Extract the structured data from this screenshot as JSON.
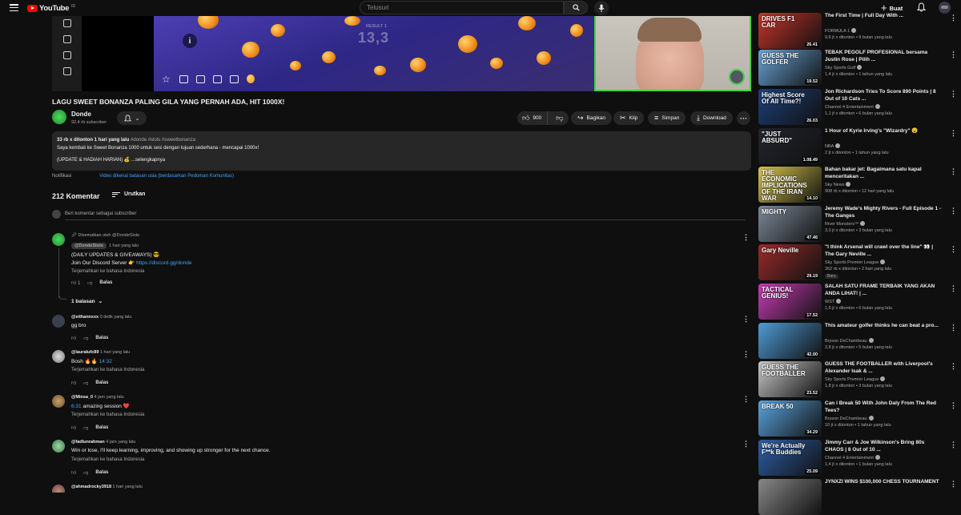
{
  "header": {
    "logo_text": "YouTube",
    "logo_region": "ID",
    "search_placeholder": "Telusuri",
    "create_label": "Buat"
  },
  "video": {
    "title": "LAGU SWEET BONANZA PALING GILA YANG PERNAH ADA, HIT 1000X!",
    "game_text": "13,3",
    "game_small_text": "RESULT 1"
  },
  "channel": {
    "name": "Donde",
    "subs": "92,4 rb subscriber"
  },
  "actions": {
    "likes": "900",
    "share": "Bagikan",
    "clip": "Klip",
    "save": "Simpan",
    "download": "Download",
    "more": "···"
  },
  "description": {
    "meta": "33 rb x ditonton  1 hari yang lalu",
    "tags": "#donde #slots #sweetbonanza",
    "line1": "Saya kembali ke Sweet Bonanza 1000 untuk sesi dengan tujuan sederhana - mencapai 1000x!",
    "line2": "(UPDATE & HADIAH HARIAN) 💰 ...selengkapnya"
  },
  "notifications": {
    "label": "Notifikasi",
    "link": "Video dikenai batasan usia (berdasarkan Pedoman Komunitas)"
  },
  "comments": {
    "count": "212 Komentar",
    "sort_label": "Urutkan",
    "add_placeholder": "Beri komentar sebagai subscriber",
    "reply_label": "Balas",
    "translate_label": "Terjemahkan ke bahasa Indonesia",
    "pinned": {
      "pinned_by": "Disematkan oleh @DondeSlots",
      "author": "@DondeSlots",
      "time": "1 hari yang lalu",
      "line1": "(DAILY UPDATES & GIVEAWAYS) 😎",
      "line2_text": "Join Our Discord Server 👉 ",
      "line2_link": "https://discord.gg/donde",
      "likes": "1",
      "replies": "1 balasan"
    },
    "items": [
      {
        "author": "@eithannxxx",
        "time": "0 detik yang lalu",
        "text": "gg bro",
        "link": ""
      },
      {
        "author": "@lauralufc89",
        "time": "1 hari yang lalu",
        "text": "Bosh 🔥🔥 ",
        "link": "14:32"
      },
      {
        "author": "@Minsa_0",
        "time": "4 jam yang lalu",
        "text": " amazing session ❤️",
        "link": "6:31"
      },
      {
        "author": "@fadlunrahman",
        "time": "4 jam yang lalu",
        "text": "Win or lose, I'll keep learning, improving, and showing up stronger for the next chance.",
        "link": ""
      },
      {
        "author": "@ahmadrocky3918",
        "time": "1 hari yang lalu",
        "text": "",
        "link": ""
      }
    ]
  },
  "recommendations": [
    {
      "title": "The First Time | Full Day With ...",
      "channel": "FORMULA 1",
      "meta": "9,6 jt x ditonton • 9 bulan yang lalu",
      "duration": "26.41",
      "thumb_text": "DRIVES F1 CAR",
      "color": "#c7342a"
    },
    {
      "title": "TEBAK PEGOLF PROFESIONAL bersama Justin Rose | Pilih ...",
      "channel": "Sky Sports Golf",
      "meta": "1,4 jt x ditonton • 1 tahun yang lalu",
      "duration": "19.52",
      "thumb_text": "GUESS THE GOLFER",
      "color": "#6aa4d8"
    },
    {
      "title": "Jon Richardson Tries To Score 890 Points | 8 Out of 10 Cats ...",
      "channel": "Channel 4 Entertainment",
      "meta": "1,1 jt x ditonton • 6 bulan yang lalu",
      "duration": "26.03",
      "thumb_text": "Highest Score Of All Time?!",
      "color": "#1d3f7a"
    },
    {
      "title": "1 Hour of Kyrie Irving's \"Wizardry\" 😮",
      "channel": "NBA",
      "meta": "2 jt x ditonton • 1 tahun yang lalu",
      "duration": "1.08.49",
      "thumb_text": "\"JUST ABSURD\"",
      "color": "#23252e"
    },
    {
      "title": "Bahan bakar jet: Bagaimana satu kapal menceritakan ...",
      "channel": "Sky News",
      "meta": "908 rb x ditonton • 12 hari yang lalu",
      "duration": "14.10",
      "thumb_text": "THE ECONOMIC IMPLICATIONS OF THE IRAN WAR",
      "color": "#d9c64a"
    },
    {
      "title": "Jeremy Wade's Mighty Rivers - Full Episode 1 - The Ganges",
      "channel": "River Monsters™",
      "meta": "3,3 jt x ditonton • 3 bulan yang lalu",
      "duration": "47.46",
      "thumb_text": "MIGHTY",
      "color": "#7d8a9a"
    },
    {
      "title": "\"I think Arsenal will crawl over the line\" 👀 | The Gary Neville ...",
      "channel": "Sky Sports Premier League",
      "meta": "362 rb x ditonton • 2 hari yang lalu",
      "duration": "29.19",
      "thumb_text": "Gary Neville",
      "color": "#9a2a2a",
      "badge": "Baru"
    },
    {
      "title": "SALAH SATU FRAME TERBAIK YANG AKAN ANDA LIHAT! | ...",
      "channel": "WST",
      "meta": "1,5 jt x ditonton • 6 bulan yang lalu",
      "duration": "17.52",
      "thumb_text": "TACTICAL GENIUS!",
      "color": "#c93cb6"
    },
    {
      "title": "This amateur golfer thinks he can beat a pro...",
      "channel": "Bryson DeChambeau",
      "meta": "3,8 jt x ditonton • 5 bulan yang lalu",
      "duration": "42.00",
      "thumb_text": "",
      "color": "#4f9bd6"
    },
    {
      "title": "GUESS THE FOOTBALLER with Liverpool's Alexander Isak & ...",
      "channel": "Sky Sports Premier League",
      "meta": "1,8 jt x ditonton • 3 bulan yang lalu",
      "duration": "23.52",
      "thumb_text": "GUESS THE FOOTBALLER",
      "color": "#c8c8c8"
    },
    {
      "title": "Can I Break 50 With John Daly From The Red Tees?",
      "channel": "Bryson DeChambeau",
      "meta": "10 jt x ditonton • 1 tahun yang lalu",
      "duration": "34.29",
      "thumb_text": "BREAK 50",
      "color": "#5aa4e0"
    },
    {
      "title": "Jimmy Carr & Joe Wilkinson's Bring 80s CHAOS | 8 Out of 10 ...",
      "channel": "Channel 4 Entertainment",
      "meta": "1,4 jt x ditonton • 1 bulan yang lalu",
      "duration": "25.09",
      "thumb_text": "We're Actually F**k Buddies",
      "color": "#2d5fa8"
    },
    {
      "title": "JYNXZI WINS $100,000 CHESS TOURNAMENT",
      "channel": "",
      "meta": "",
      "duration": "",
      "thumb_text": "",
      "color": "#888"
    }
  ]
}
